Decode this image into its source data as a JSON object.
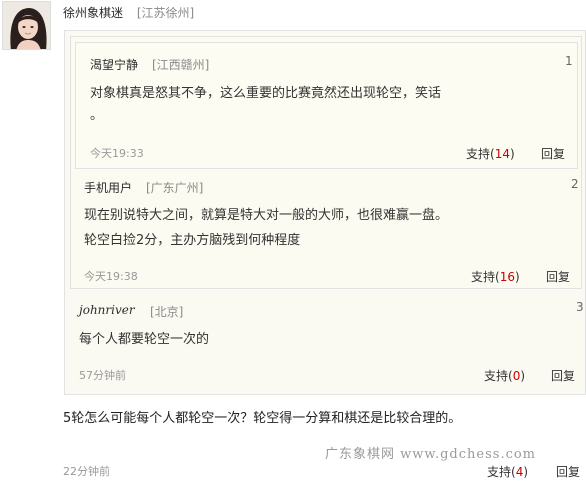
{
  "poster": {
    "name": "徐州象棋迷",
    "location": "[江苏徐州]"
  },
  "quotes": [
    {
      "floor": "1",
      "name": "渴望宁静",
      "location": "[江西赣州]",
      "lines": [
        "对象棋真是怒其不争，这么重要的比赛竟然还出现轮空，笑话",
        "。"
      ],
      "time": "今天19:33",
      "support_label": "支持(",
      "support_count": "14",
      "support_close": ")",
      "reply": "回复"
    },
    {
      "floor": "2",
      "name": "手机用户",
      "location": "[广东广州]",
      "lines": [
        "现在别说特大之间，就算是特大对一般的大师，也很难赢一盘。",
        "轮空白捡2分，主办方脑残到何种程度"
      ],
      "time": "今天19:38",
      "support_label": "支持(",
      "support_count": "16",
      "support_close": ")",
      "reply": "回复"
    },
    {
      "floor": "3",
      "name": "johnriver",
      "location": "[北京]",
      "lines": [
        "每个人都要轮空一次的"
      ],
      "time": "57分钟前",
      "support_label": "支持(",
      "support_count": "0",
      "support_close": ")",
      "reply": "回复"
    }
  ],
  "main": {
    "text": "5轮怎么可能每个人都轮空一次？轮空得一分算和棋还是比较合理的。",
    "time": "22分钟前",
    "support_label": "支持(",
    "support_count": "4",
    "support_close": ")",
    "reply": "回复"
  },
  "watermark": "广东象棋网 www.gdchess.com"
}
